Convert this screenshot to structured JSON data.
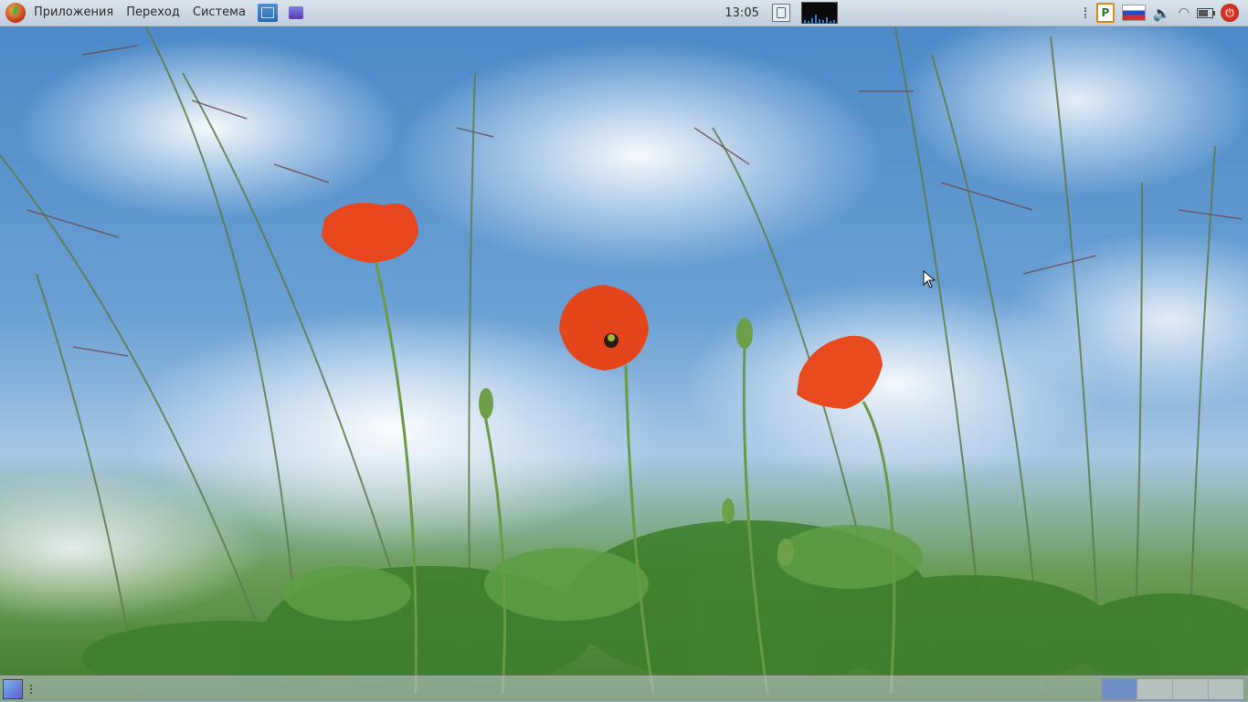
{
  "top_panel": {
    "menus": [
      "Приложения",
      "Переход",
      "Система"
    ],
    "clock": "13:05",
    "icons": {
      "app_menu": "mint-leaf-logo-icon",
      "launcher_1": "network-manager-launcher-icon",
      "launcher_2": "workspace-launcher-icon",
      "clipboard": "clipboard-icon",
      "system_monitor": "system-monitor-icon",
      "keyboard_layout": "keyboard-indicator-icon",
      "language": "russia-flag-icon",
      "volume": "volume-icon",
      "wifi": "wifi-icon",
      "battery": "battery-icon",
      "power": "power-icon"
    },
    "keyboard_indicator_letter": "P"
  },
  "bottom_panel": {
    "icons": {
      "show_desktop": "show-desktop-icon"
    },
    "workspaces": [
      {
        "active": true
      },
      {
        "active": false
      },
      {
        "active": false
      },
      {
        "active": false
      }
    ]
  },
  "colors": {
    "panel": "#d6dce2",
    "sky": "#4a88c8",
    "poppy": "#e8461c",
    "active_workspace": "#6f8fc6"
  }
}
